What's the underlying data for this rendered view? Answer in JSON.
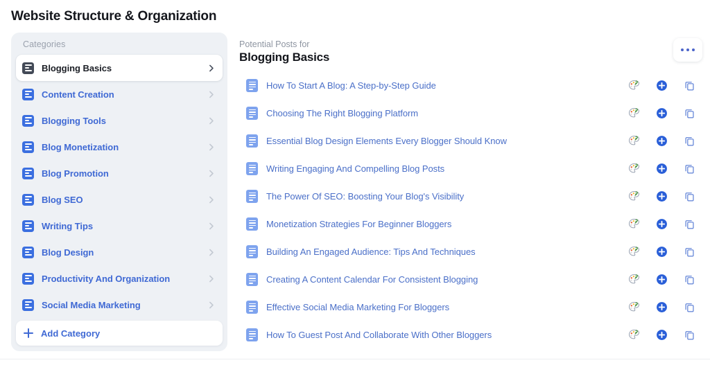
{
  "page": {
    "title": "Website Structure & Organization"
  },
  "sidebar": {
    "heading": "Categories",
    "add_category_label": "Add Category",
    "items": [
      {
        "label": "Blogging Basics",
        "selected": true
      },
      {
        "label": "Content Creation",
        "selected": false
      },
      {
        "label": "Blogging Tools",
        "selected": false
      },
      {
        "label": "Blog Monetization",
        "selected": false
      },
      {
        "label": "Blog Promotion",
        "selected": false
      },
      {
        "label": "Blog SEO",
        "selected": false
      },
      {
        "label": "Writing Tips",
        "selected": false
      },
      {
        "label": "Blog Design",
        "selected": false
      },
      {
        "label": "Productivity And Organization",
        "selected": false
      },
      {
        "label": "Social Media Marketing",
        "selected": false
      }
    ]
  },
  "main": {
    "eyebrow": "Potential Posts for",
    "title": "Blogging Basics",
    "more_button_label": "...",
    "posts": [
      {
        "title": "How To Start A Blog: A Step-by-Step Guide"
      },
      {
        "title": "Choosing The Right Blogging Platform"
      },
      {
        "title": "Essential Blog Design Elements Every Blogger Should Know"
      },
      {
        "title": "Writing Engaging And Compelling Blog Posts"
      },
      {
        "title": "The Power Of SEO: Boosting Your Blog's Visibility"
      },
      {
        "title": "Monetization Strategies For Beginner Bloggers"
      },
      {
        "title": "Building An Engaged Audience: Tips And Techniques"
      },
      {
        "title": "Creating A Content Calendar For Consistent Blogging"
      },
      {
        "title": "Effective Social Media Marketing For Bloggers"
      },
      {
        "title": "How To Guest Post And Collaborate With Other Bloggers"
      }
    ],
    "row_actions": [
      {
        "name": "generate-image-icon"
      },
      {
        "name": "add-post-icon"
      },
      {
        "name": "duplicate-post-icon"
      }
    ]
  },
  "colors": {
    "accent_blue": "#3f69d4",
    "link_blue": "#4a6fc8",
    "post_icon_blue": "#7ea3ee",
    "sidebar_bg": "#eef1f5",
    "selected_icon": "#434a57",
    "muted_text": "#9aa1ad",
    "title_text": "#14161c"
  }
}
